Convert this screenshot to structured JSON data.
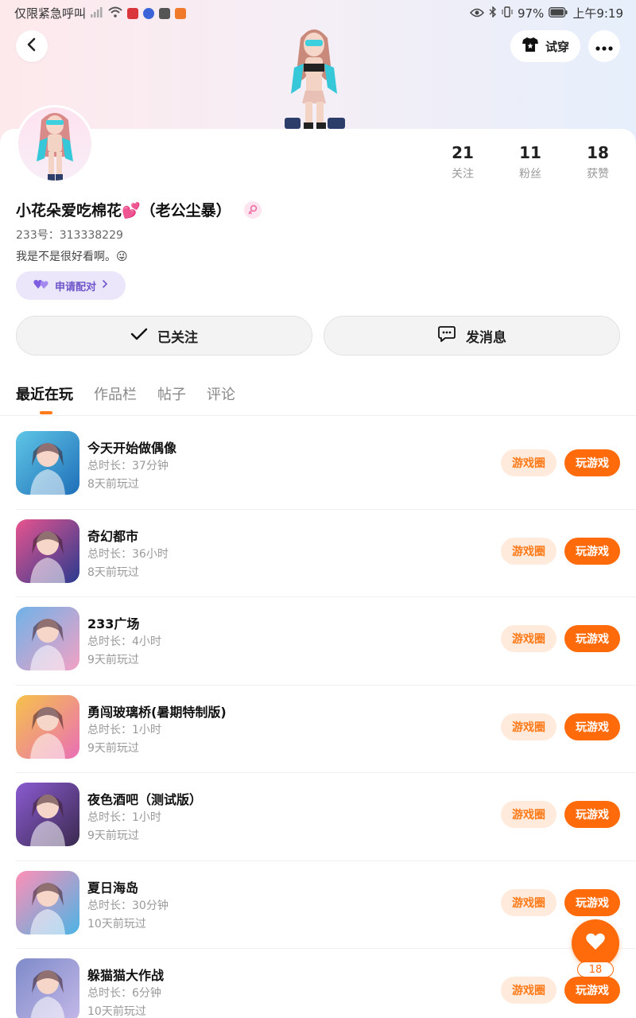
{
  "status_bar": {
    "left_text": "仅限紧急呼叫",
    "battery": "97%",
    "time": "上午9:19"
  },
  "header": {
    "tryon_label": "试穿"
  },
  "profile": {
    "nickname": "小花朵爱吃棉花💕（老公尘暴）",
    "uid": "233号：313338229",
    "bio": "我是不是很好看啊。😜",
    "pair_label": "申请配对",
    "stats": [
      {
        "num": "21",
        "label": "关注"
      },
      {
        "num": "11",
        "label": "粉丝"
      },
      {
        "num": "18",
        "label": "获赞"
      }
    ],
    "follow_label": "已关注",
    "message_label": "发消息"
  },
  "tabs": [
    {
      "label": "最近在玩",
      "active": true
    },
    {
      "label": "作品栏",
      "active": false
    },
    {
      "label": "帖子",
      "active": false
    },
    {
      "label": "评论",
      "active": false
    }
  ],
  "buttons": {
    "circle": "游戏圈",
    "play": "玩游戏"
  },
  "games": [
    {
      "name": "今天开始做偶像",
      "duration": "总时长：37分钟",
      "last": "8天前玩过",
      "c1": "#5fc6e6",
      "c2": "#1f6fb8"
    },
    {
      "name": "奇幻都市",
      "duration": "总时长：36小时",
      "last": "8天前玩过",
      "c1": "#e8548f",
      "c2": "#2a3b8f"
    },
    {
      "name": "233广场",
      "duration": "总时长：4小时",
      "last": "9天前玩过",
      "c1": "#6fb2e8",
      "c2": "#f3a1c4"
    },
    {
      "name": "勇闯玻璃桥(暑期特制版)",
      "duration": "总时长：1小时",
      "last": "9天前玩过",
      "c1": "#f6c24a",
      "c2": "#e96fb6"
    },
    {
      "name": "夜色酒吧（测试版）",
      "duration": "总时长：1小时",
      "last": "9天前玩过",
      "c1": "#8a5bd1",
      "c2": "#3b2a4f"
    },
    {
      "name": "夏日海岛",
      "duration": "总时长：30分钟",
      "last": "10天前玩过",
      "c1": "#ff8fb6",
      "c2": "#4bb4e6"
    },
    {
      "name": "躲猫猫大作战",
      "duration": "总时长：6分钟",
      "last": "10天前玩过",
      "c1": "#7e8bc9",
      "c2": "#c4b8e8"
    }
  ],
  "like_count": "18",
  "colors": {
    "accent": "#ff6a0a",
    "accent_light": "#ffeadb",
    "pair_bg": "#ece6fb",
    "pair_text": "#6d55c9"
  }
}
